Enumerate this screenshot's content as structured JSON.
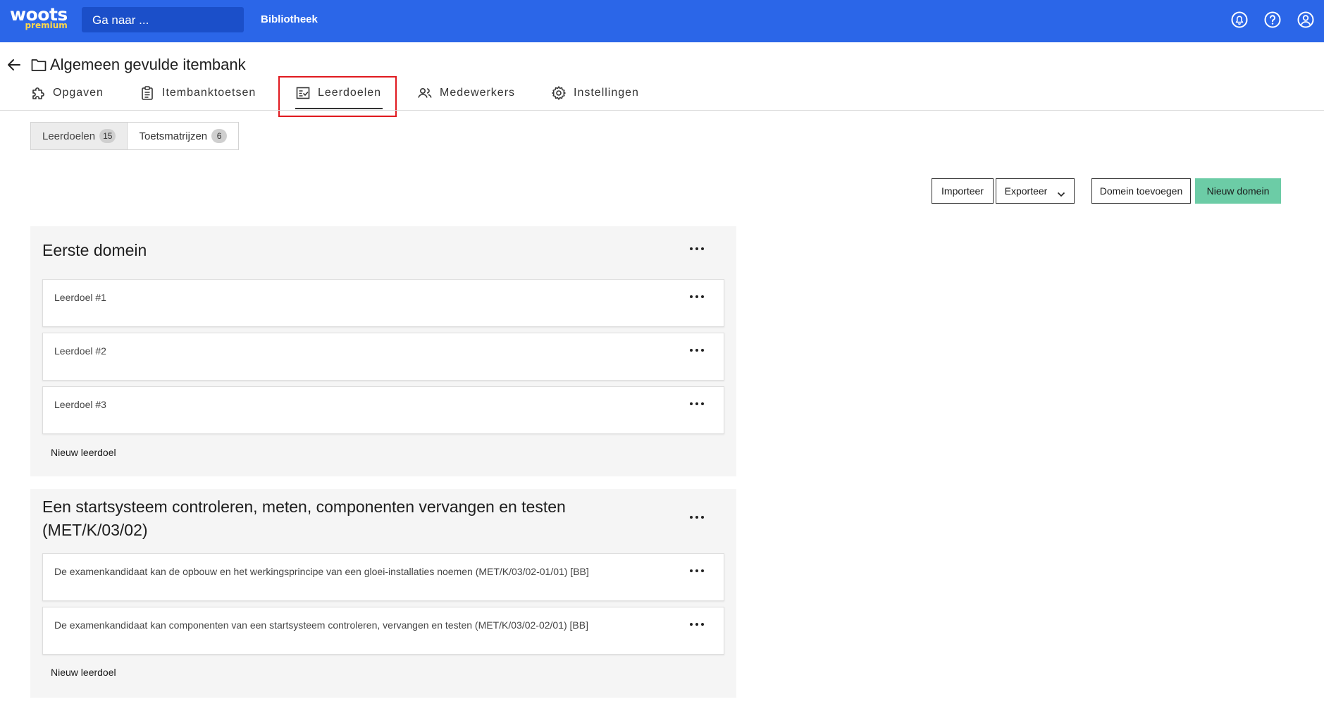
{
  "app": {
    "logo_word": "woots",
    "logo_sub": "premium",
    "goto_placeholder": "Ga naar ...",
    "library_link": "Bibliotheek"
  },
  "header": {
    "title": "Algemeen gevulde itembank"
  },
  "nav_tabs": [
    {
      "label": "Opgaven",
      "icon": "puzzle-icon"
    },
    {
      "label": "Itembanktoetsen",
      "icon": "clipboard-icon"
    },
    {
      "label": "Leerdoelen",
      "icon": "checklist-icon",
      "active": true
    },
    {
      "label": "Medewerkers",
      "icon": "users-icon"
    },
    {
      "label": "Instellingen",
      "icon": "gear-icon"
    }
  ],
  "subtabs": [
    {
      "label": "Leerdoelen",
      "count": "15",
      "active": true
    },
    {
      "label": "Toetsmatrijzen",
      "count": "6"
    }
  ],
  "actions": {
    "import": "Importeer",
    "export": "Exporteer",
    "add_domain": "Domein toevoegen",
    "new_domain": "Nieuw domein"
  },
  "domains": [
    {
      "title": "Eerste domein",
      "goals": [
        "Leerdoel #1",
        "Leerdoel #2",
        "Leerdoel #3"
      ],
      "new_goal": "Nieuw leerdoel"
    },
    {
      "title_line1": "Een startsysteem controleren, meten, componenten vervangen en testen",
      "title_line2": "(MET/K/03/02)",
      "goals": [
        "De examenkandidaat kan de opbouw en het werkingsprincipe van een gloei-installaties noemen (MET/K/03/02-01/01) [BB]",
        "De examenkandidaat kan componenten van een startsysteem controleren, vervangen en testen (MET/K/03/02-02/01) [BB]"
      ],
      "new_goal": "Nieuw leerdoel"
    }
  ],
  "colors": {
    "topbar": "#2b66e8",
    "primary_button": "#6ccca6",
    "highlight": "#e0191f",
    "logo_accent": "#ffd84a"
  }
}
